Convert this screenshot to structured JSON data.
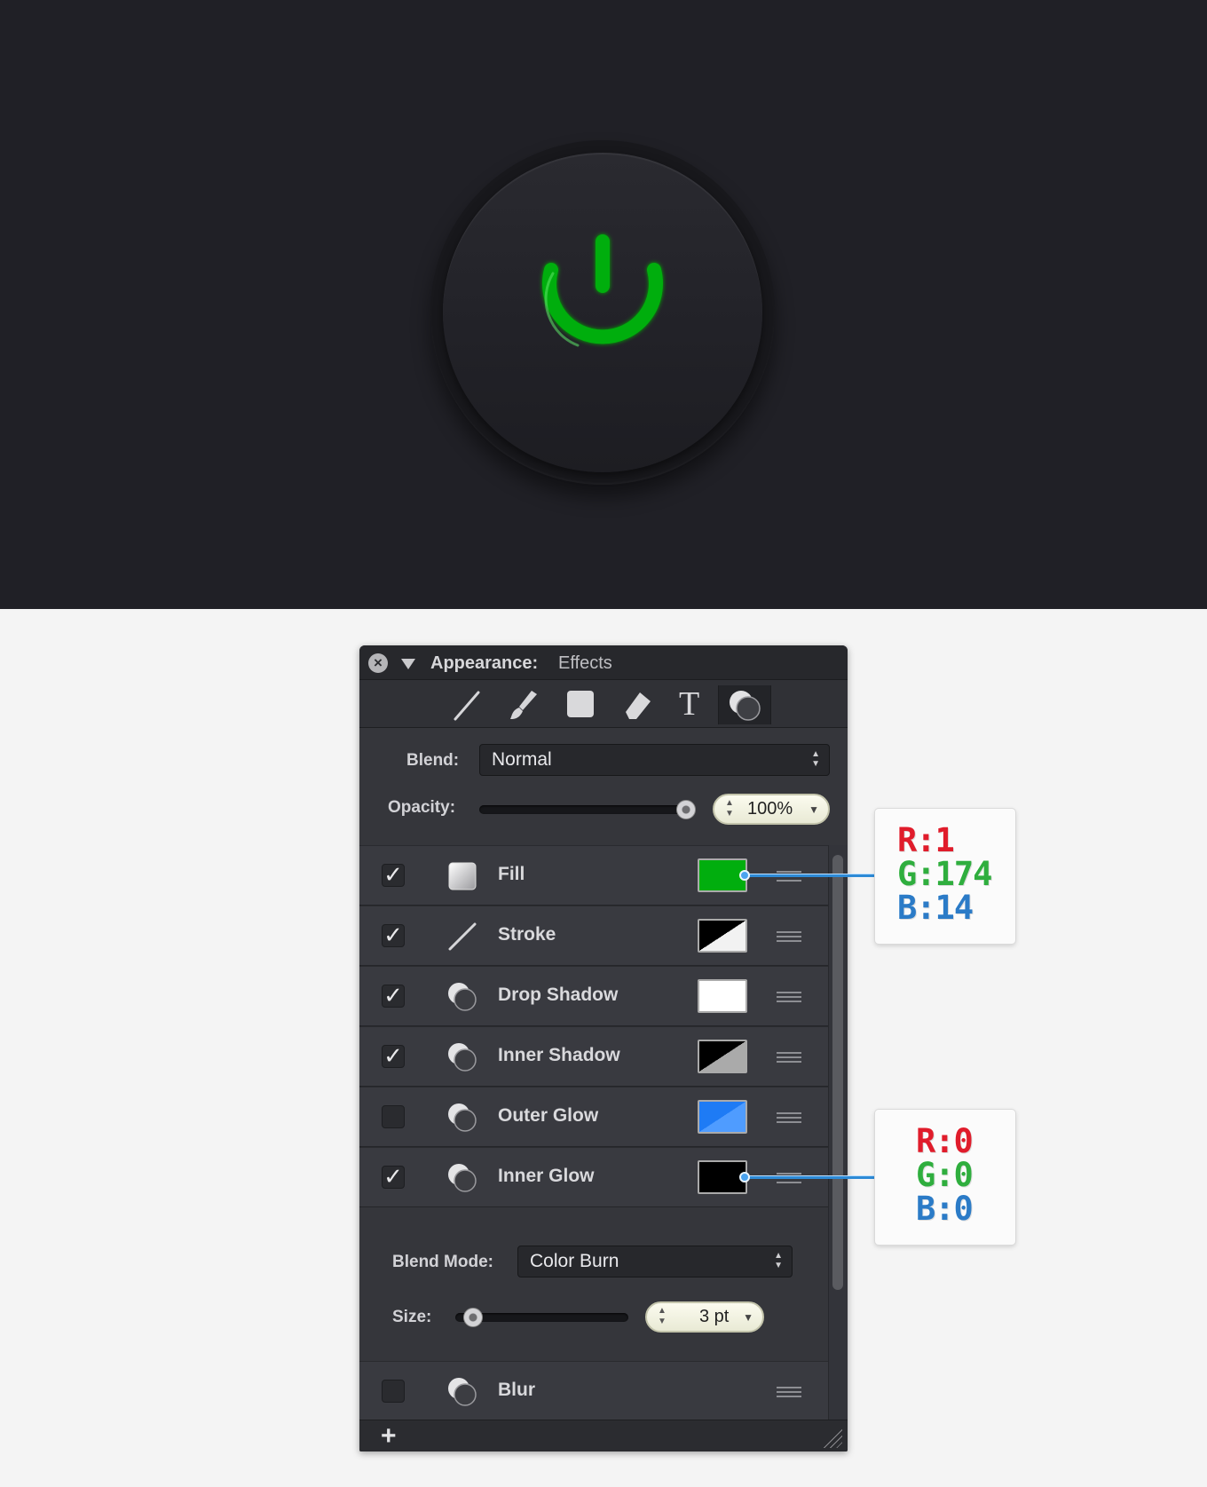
{
  "panel": {
    "title": "Appearance:",
    "subtitle": "Effects",
    "tools": [
      "line-tool-icon",
      "brush-tool-icon",
      "fill-tool-icon",
      "eraser-tool-icon",
      "text-tool-icon",
      "effects-tool-icon"
    ],
    "text_tool_glyph": "T",
    "blend_label": "Blend:",
    "blend_value": "Normal",
    "opacity_label": "Opacity:",
    "opacity_value": "100%",
    "opacity_level": 1.0,
    "rows": [
      {
        "label": "Fill",
        "checked": true,
        "swatch": "green",
        "color": "#01AE0E"
      },
      {
        "label": "Stroke",
        "checked": true,
        "swatch": "black-white-diagonal"
      },
      {
        "label": "Drop Shadow",
        "checked": true,
        "swatch": "white",
        "color": "#FFFFFF"
      },
      {
        "label": "Inner Shadow",
        "checked": true,
        "swatch": "black-gray-diagonal"
      },
      {
        "label": "Outer Glow",
        "checked": false,
        "swatch": "blue-diagonal",
        "color": "#1E7BF5"
      },
      {
        "label": "Inner Glow",
        "checked": true,
        "swatch": "black",
        "color": "#000000"
      }
    ],
    "blend_mode_label": "Blend Mode:",
    "blend_mode_value": "Color Burn",
    "size_label": "Size:",
    "size_value": "3 pt",
    "blur_label": "Blur",
    "blur_checked": false,
    "check_glyph": "✓",
    "add_glyph": "+"
  },
  "callouts": [
    {
      "r": "R:1",
      "g": "G:174",
      "b": "B:14"
    },
    {
      "r": "R:0",
      "g": "G:0",
      "b": "B:0"
    }
  ],
  "power_color": "#01AE0E",
  "canvas_bg": "#202026"
}
